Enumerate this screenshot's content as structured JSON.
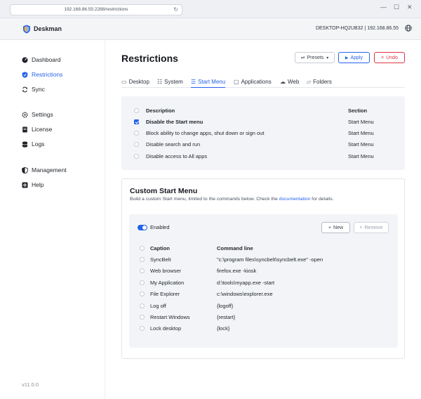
{
  "browser": {
    "url_host": "192.168.86.55:2288",
    "url_path": "/restrictions",
    "controls": {
      "minimize": "—",
      "maximize": "☐",
      "close": "✕"
    }
  },
  "header": {
    "brand": "Deskman",
    "host_info": "DESKTOP-HQ2UB32 | 192.168.86.55",
    "logo_icon": "shield-logo-icon",
    "lang_icon": "globe-icon"
  },
  "sidebar": {
    "items": [
      {
        "label": "Dashboard",
        "icon": "dashboard-icon"
      },
      {
        "label": "Restrictions",
        "icon": "shield-icon"
      },
      {
        "label": "Sync",
        "icon": "sync-icon"
      },
      {
        "label": "Settings",
        "icon": "gear-icon"
      },
      {
        "label": "License",
        "icon": "license-icon"
      },
      {
        "label": "Logs",
        "icon": "database-icon"
      },
      {
        "label": "Management",
        "icon": "shield-half-icon"
      },
      {
        "label": "Help",
        "icon": "help-icon"
      }
    ],
    "active": "Restrictions",
    "version": "v11.0.0"
  },
  "main": {
    "title": "Restrictions",
    "buttons": {
      "presets": "Presets",
      "apply": "Apply",
      "undo": "Undo"
    },
    "tabs": [
      {
        "label": "Desktop",
        "icon": "monitor-icon"
      },
      {
        "label": "System",
        "icon": "system-icon"
      },
      {
        "label": "Start Menu",
        "icon": "start-menu-icon"
      },
      {
        "label": "Applications",
        "icon": "window-icon"
      },
      {
        "label": "Web",
        "icon": "cloud-icon"
      },
      {
        "label": "Folders",
        "icon": "folder-icon"
      }
    ],
    "active_tab": "Start Menu",
    "restrictions_table": {
      "headers": {
        "description": "Description",
        "section": "Section"
      },
      "rows": [
        {
          "description": "Disable the Start menu",
          "section": "Start Menu",
          "checked": true
        },
        {
          "description": "Block ability to change apps, shut down or sign out",
          "section": "Start Menu",
          "checked": false
        },
        {
          "description": "Disable search and run",
          "section": "Start Menu",
          "checked": false
        },
        {
          "description": "Disable access to All apps",
          "section": "Start Menu",
          "checked": false
        }
      ]
    },
    "custom_start_menu": {
      "title": "Custom Start Menu",
      "description_prefix": "Build a custom Start menu, limited to the commands below. Check the ",
      "description_link": "documentation",
      "description_suffix": " for details.",
      "enabled_label": "Enabled",
      "enabled": true,
      "new_label": "New",
      "remove_label": "Remove",
      "headers": {
        "caption": "Caption",
        "command": "Command line"
      },
      "rows": [
        {
          "caption": "SyncBelt",
          "command": "\"c:\\program files\\syncbelt\\syncbelt.exe\" -open"
        },
        {
          "caption": "Web browser",
          "command": "firefox.exe -kiosk"
        },
        {
          "caption": "My Application",
          "command": "d:\\tools\\myapp.exe -start"
        },
        {
          "caption": "File Explorer",
          "command": "c:\\windows\\explorer.exe"
        },
        {
          "caption": "Log off",
          "command": "{logoff}"
        },
        {
          "caption": "Restart Windows",
          "command": "{restart}"
        },
        {
          "caption": "Lock desktop",
          "command": "{lock}"
        }
      ]
    }
  },
  "colors": {
    "accent": "#2563eb",
    "danger": "#dc3545",
    "panel_bg": "#f2f4f7"
  }
}
